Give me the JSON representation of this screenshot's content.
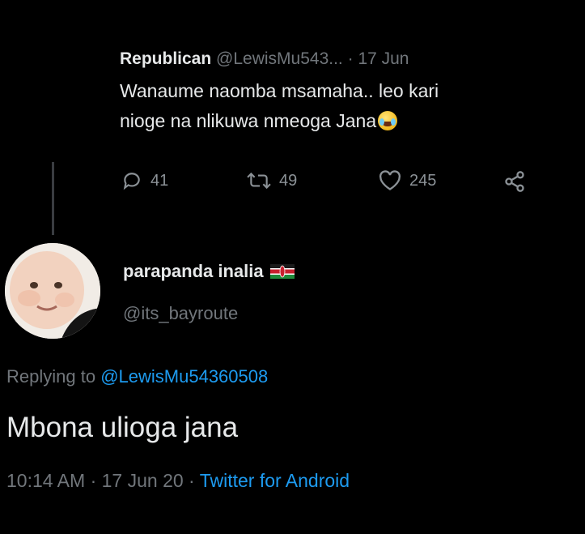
{
  "parent_tweet": {
    "display_name": "Republican",
    "handle": "@LewisMu543...",
    "separator": " · ",
    "date": "17 Jun",
    "text_line1": "Wanaume naomba msamaha.. leo kari",
    "text_line2": "nioge na nlikuwa nmeoga Jana",
    "emoji": "face-with-tears-of-joy",
    "actions": {
      "replies": "41",
      "retweets": "49",
      "likes": "245"
    }
  },
  "reply_tweet": {
    "display_name": "parapanda inalia",
    "flag": "kenya-flag",
    "handle": "@its_bayroute",
    "replying_prefix": "Replying to",
    "replying_to": "@LewisMu54360508",
    "text": "Mbona ulioga jana",
    "time": "10:14 AM",
    "separator": " · ",
    "date": "17 Jun 20",
    "separator2": " · ",
    "source": "Twitter for Android"
  },
  "colors": {
    "background": "#000000",
    "text": "#e7e9ea",
    "muted": "#71767b",
    "link": "#1d9bf0"
  }
}
